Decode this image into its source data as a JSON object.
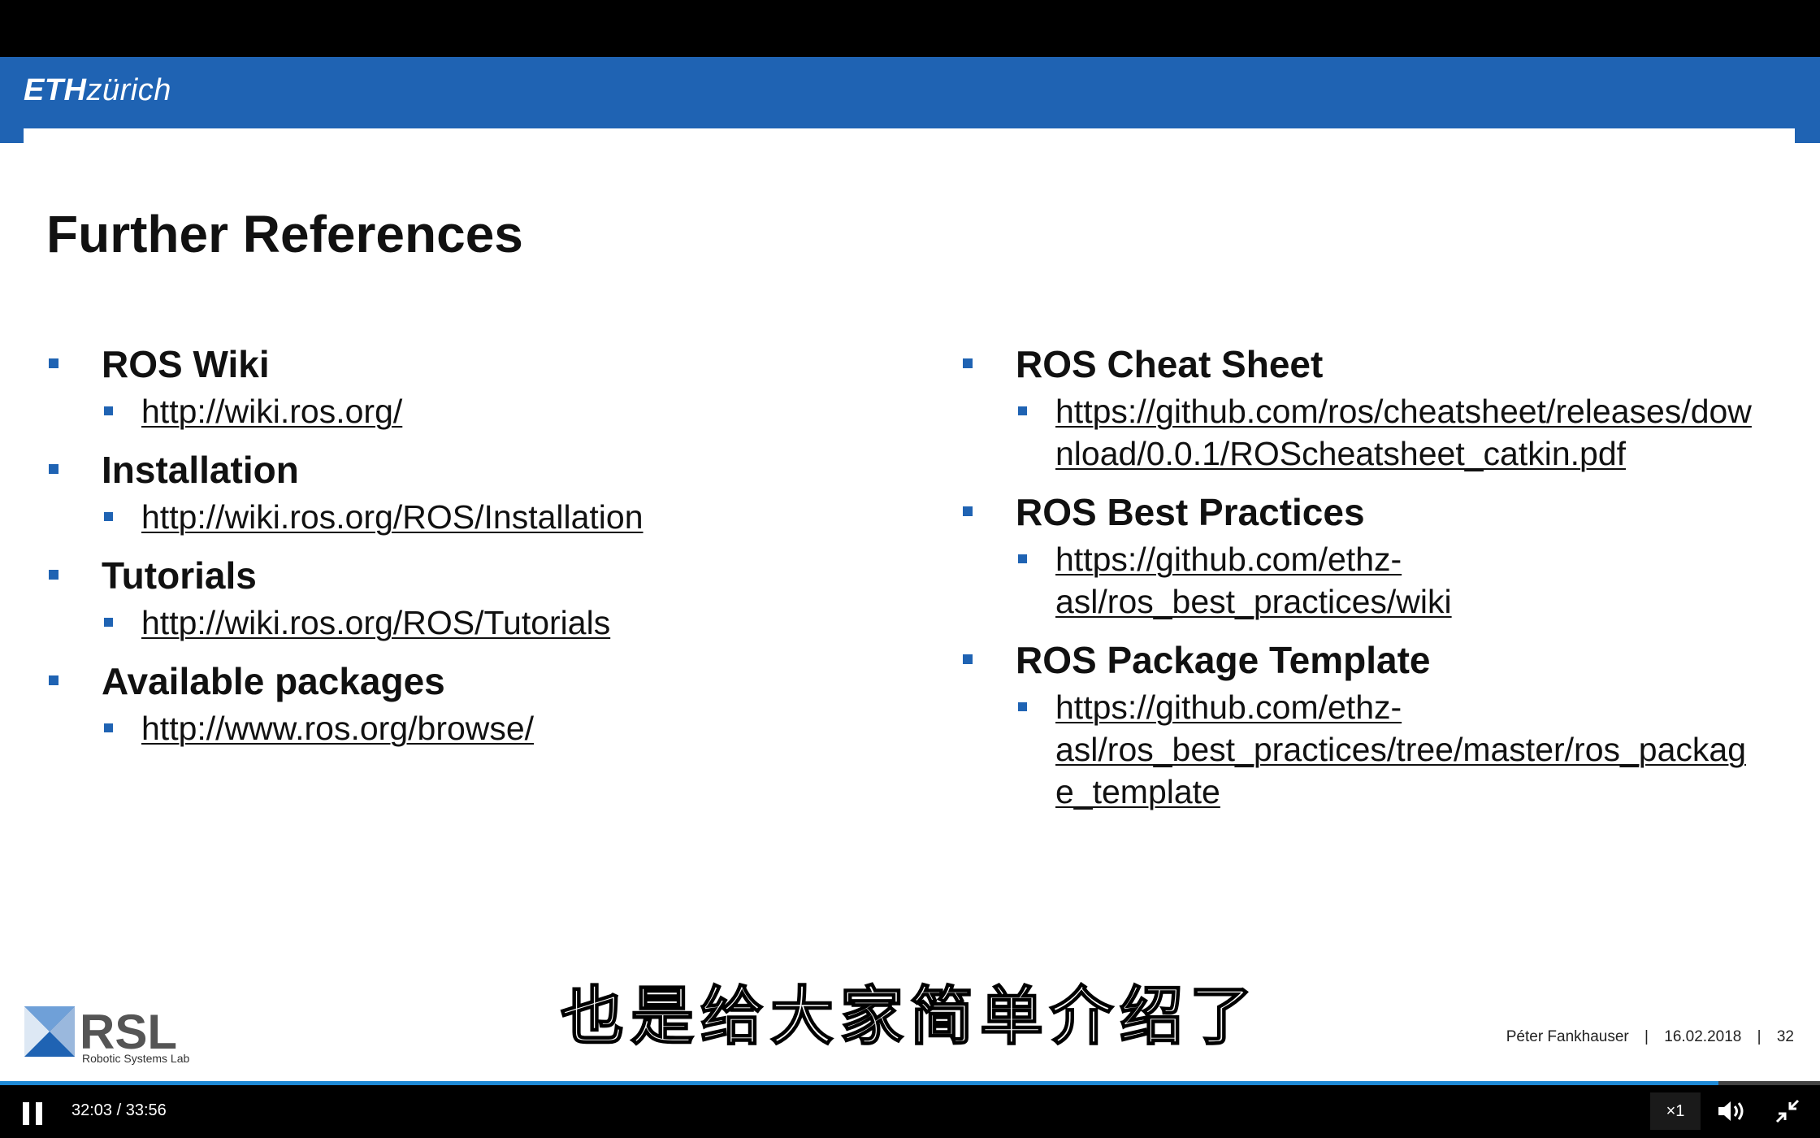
{
  "slide": {
    "brand": {
      "bold": "ETH",
      "italic": "zürich"
    },
    "title": "Further References",
    "left_items": [
      {
        "heading": "ROS Wiki",
        "links": [
          "http://wiki.ros.org/"
        ]
      },
      {
        "heading": "Installation",
        "links": [
          "http://wiki.ros.org/ROS/Installation"
        ]
      },
      {
        "heading": "Tutorials",
        "links": [
          "http://wiki.ros.org/ROS/Tutorials"
        ]
      },
      {
        "heading": "Available packages",
        "links": [
          "http://www.ros.org/browse/"
        ]
      }
    ],
    "right_items": [
      {
        "heading": "ROS Cheat Sheet",
        "link_lines": [
          "https://github.com/ros/cheatsheet/releases/dow",
          "nload/0.0.1/ROScheatsheet_catkin.pdf"
        ]
      },
      {
        "heading": "ROS Best Practices",
        "link_lines": [
          "https://github.com/ethz-",
          "asl/ros_best_practices/wiki"
        ]
      },
      {
        "heading": "ROS Package Template",
        "link_lines": [
          "https://github.com/ethz-",
          "asl/ros_best_practices/tree/master/ros_packag",
          "e_template"
        ]
      }
    ],
    "rsl_caption": "Robotic Systems Lab",
    "footer": {
      "author": "Péter Fankhauser",
      "sep1": "|",
      "date": "16.02.2018",
      "sep2": "|",
      "page": "32"
    }
  },
  "subtitle": "也是给大家简单介绍了",
  "player": {
    "time": "32:03 / 33:56",
    "progress": 0.944,
    "speed": "×1",
    "accent": "#1f8ad6"
  },
  "colors": {
    "eth_blue": "#1f63b3"
  }
}
